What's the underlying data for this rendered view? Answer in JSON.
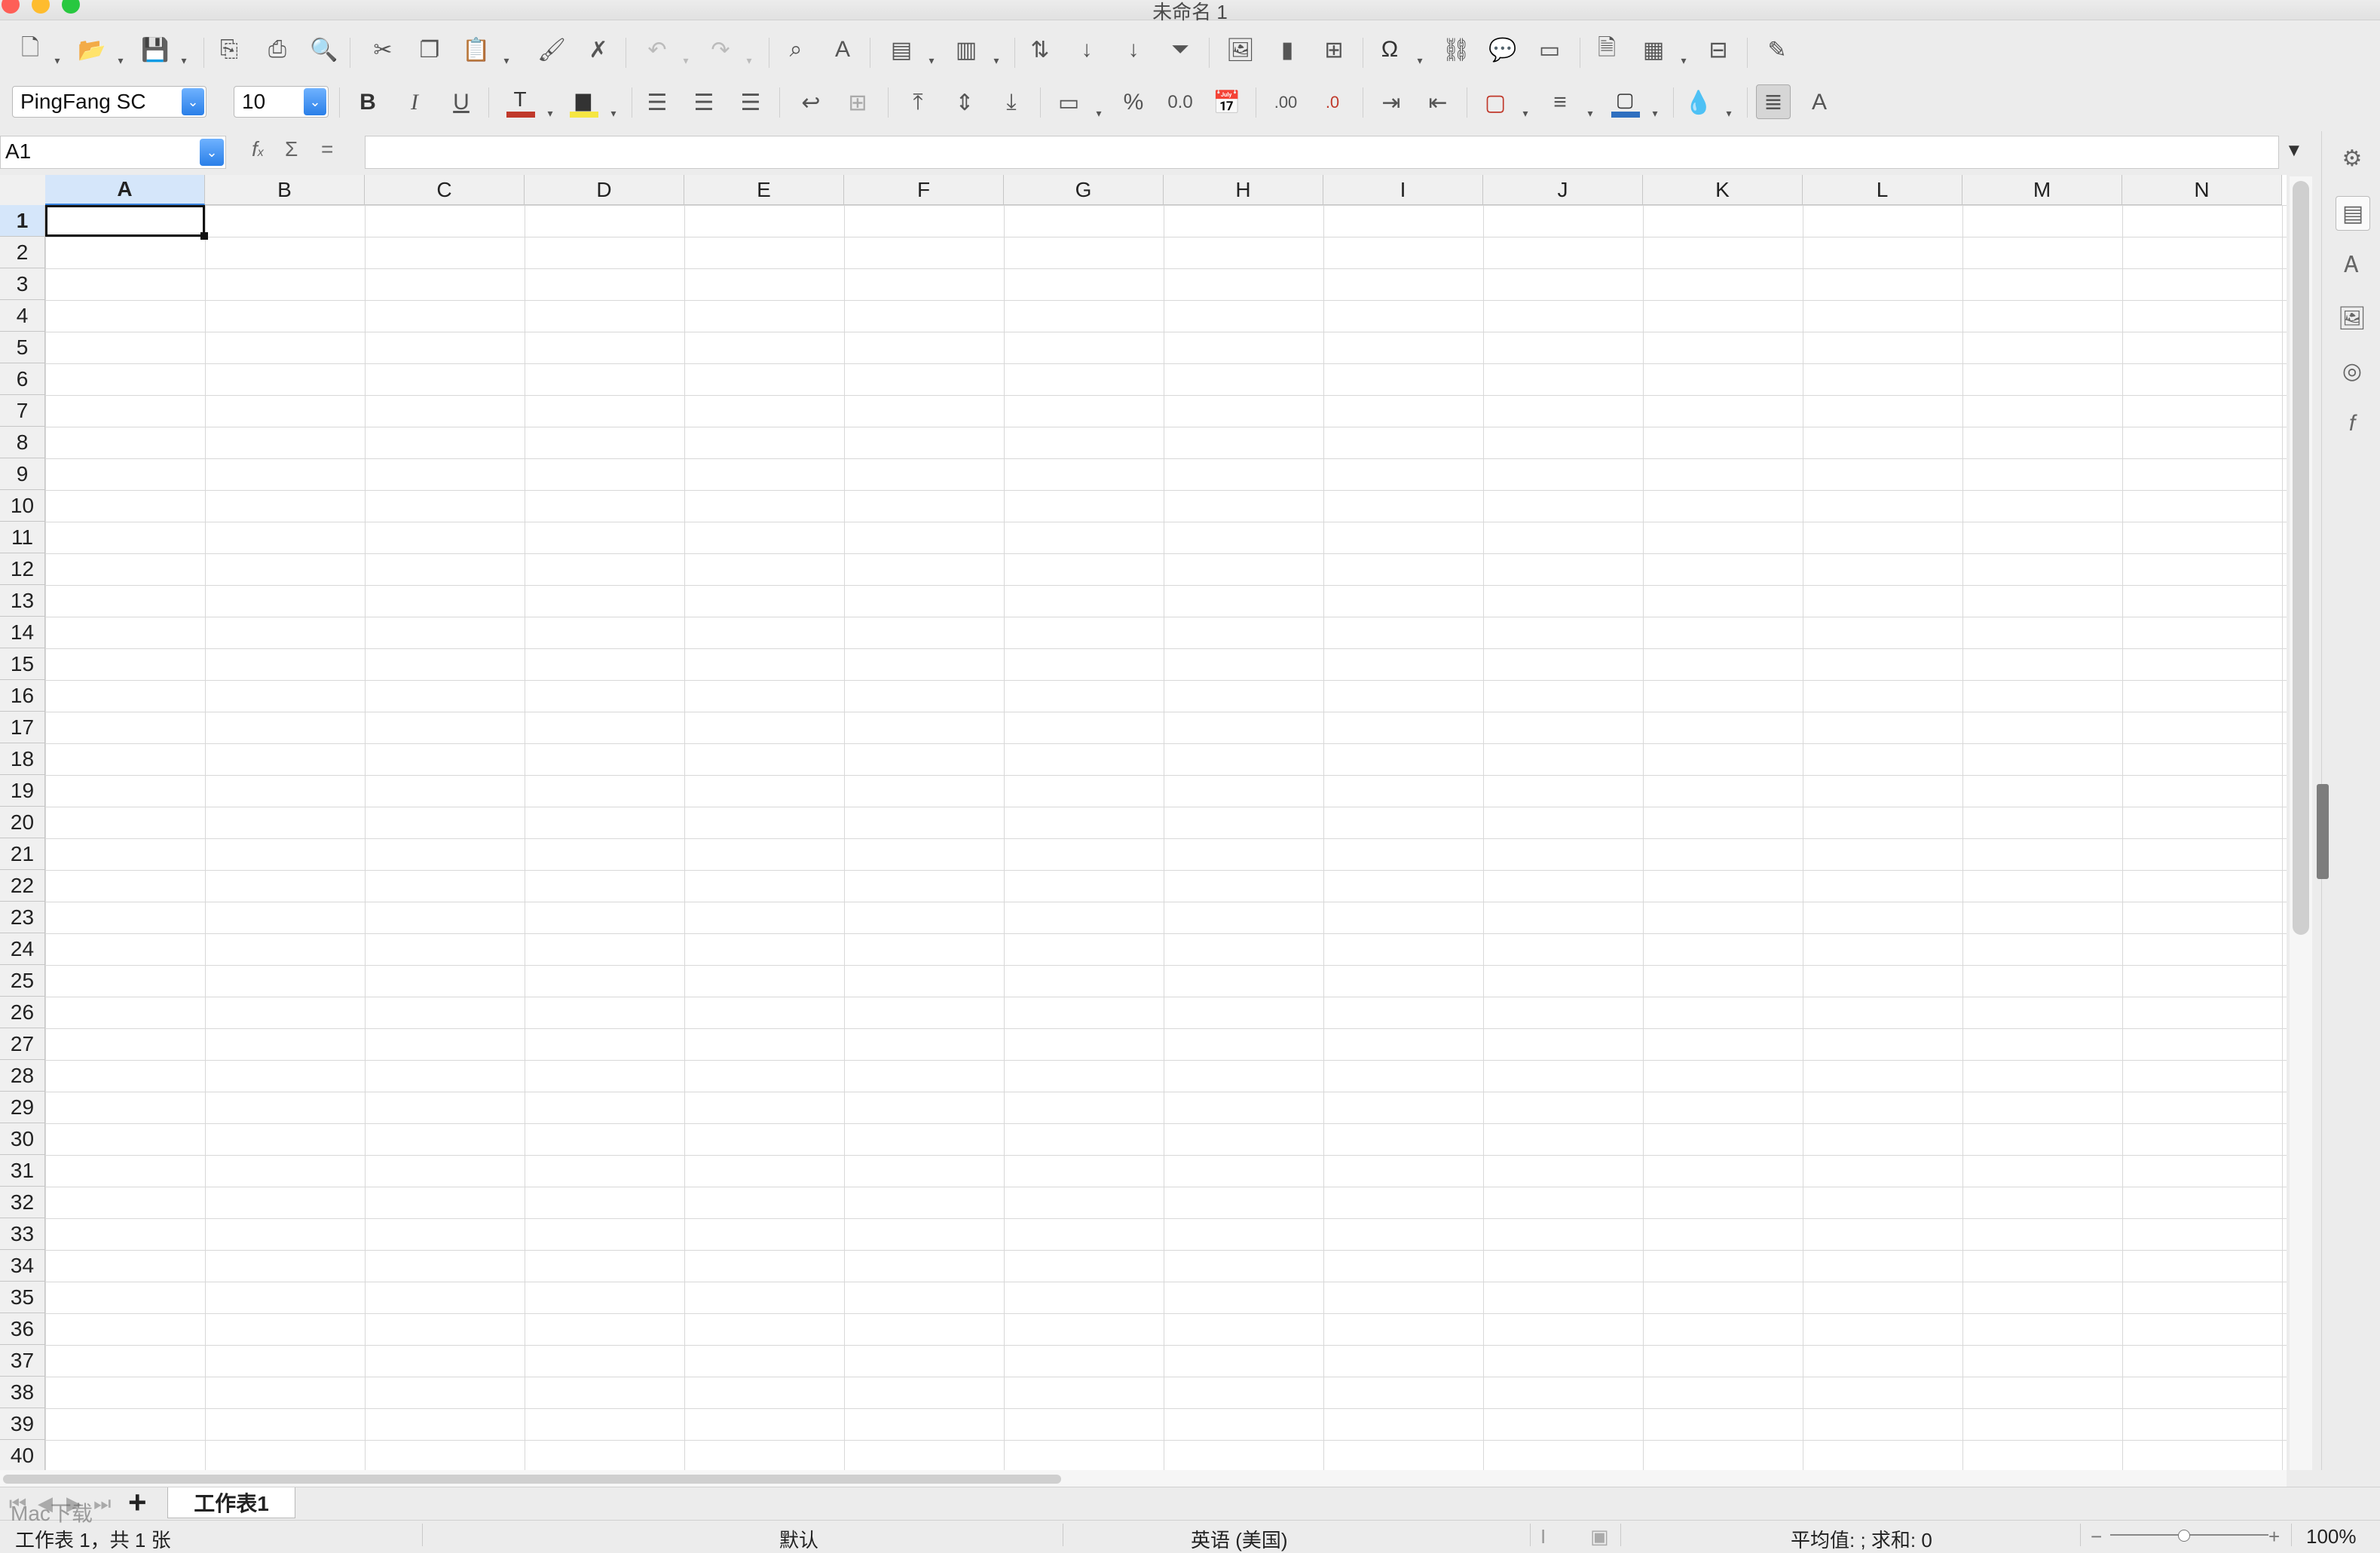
{
  "window": {
    "title": "未命名 1",
    "traffic_colors": [
      "#fe5f57",
      "#febc2e",
      "#28c840"
    ]
  },
  "toolbar1": {
    "icons": [
      "new-document-icon",
      "open-icon",
      "save-icon",
      "export-pdf-icon",
      "print-icon",
      "print-preview-icon",
      "cut-icon",
      "copy-icon",
      "paste-icon",
      "clone-formatting-icon",
      "clear-formatting-icon",
      "undo-icon",
      "redo-icon",
      "find-replace-icon",
      "spelling-icon",
      "row-icon",
      "column-icon",
      "sort-icon",
      "sort-ascending-icon",
      "sort-descending-icon",
      "autofilter-icon",
      "insert-image-icon",
      "insert-chart-icon",
      "pivot-table-icon",
      "special-character-icon",
      "hyperlink-icon",
      "comment-icon",
      "headers-footers-icon",
      "define-print-area-icon",
      "freeze-rows-columns-icon",
      "split-window-icon",
      "show-draw-functions-icon"
    ]
  },
  "toolbar2": {
    "font_name": "PingFang SC",
    "font_size": "10",
    "font_color": "#c0392b",
    "highlight_color": "#f5e642",
    "border_color": "#c0392b",
    "cell_bg_color": "#2f6fbf"
  },
  "formula_bar": {
    "name_box": "A1",
    "function_wizard_label": "f",
    "sum_label": "Σ",
    "equals_label": "=",
    "formula_value": ""
  },
  "sheet": {
    "columns": [
      "A",
      "B",
      "C",
      "D",
      "E",
      "F",
      "G",
      "H",
      "I",
      "J",
      "K",
      "L",
      "M",
      "N"
    ],
    "rows": [
      "1",
      "2",
      "3",
      "4",
      "5",
      "6",
      "7",
      "8",
      "9",
      "10",
      "11",
      "12",
      "13",
      "14",
      "15",
      "16",
      "17",
      "18",
      "19",
      "20",
      "21",
      "22",
      "23",
      "24",
      "25",
      "26",
      "27",
      "28",
      "29",
      "30",
      "31",
      "32",
      "33",
      "34",
      "35",
      "36",
      "37",
      "38",
      "39",
      "40"
    ],
    "selected_column": "A",
    "selected_row": "1"
  },
  "tabs": {
    "add_label": "+",
    "sheet_name": "工作表1"
  },
  "status": {
    "sheet_position": "工作表 1，共 1 张",
    "page_style": "默认",
    "language": "英语 (美国)",
    "selection_summary": "平均值: ; 求和: 0",
    "zoom": "100%"
  },
  "watermark": {
    "text": "Mac下载"
  }
}
